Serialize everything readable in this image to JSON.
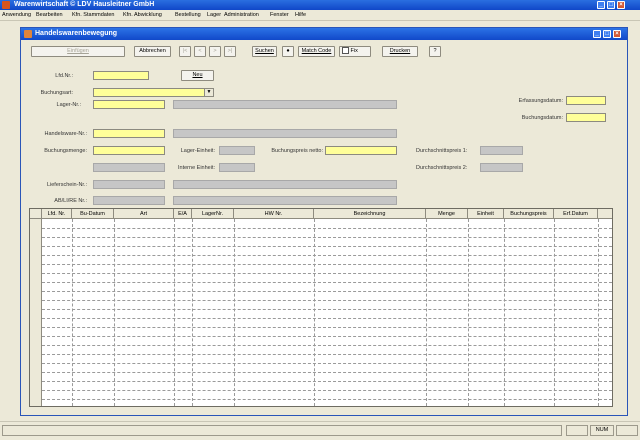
{
  "app": {
    "title": "Warenwirtschaft  © LDV Hausleitner GmbH"
  },
  "menu": [
    "Anwendung",
    "Bearbeiten",
    "Kfn. Stammdaten",
    "Kfn. Abwicklung",
    "Bestellung",
    "Lager",
    "Administration",
    "Fenster",
    "Hilfe"
  ],
  "window": {
    "title": "Handelswarenbewegung"
  },
  "toolbar": {
    "einfuegen": "Einfügen",
    "abbrechen": "Abbrechen",
    "nav_first": "|<",
    "nav_prev": "<",
    "nav_next": ">",
    "nav_last": ">|",
    "suchen": "Suchen",
    "dot": "●",
    "matchcode": "Match Code",
    "fix": "Fix",
    "drucken": "Drucken",
    "help": "?"
  },
  "form": {
    "lfd_nr": "Lfd.Nr.:",
    "neu": "Neu",
    "buchungsart": "Buchungsart:",
    "lager_nr": "Lager-Nr.:",
    "erfassungsdatum": "Erfassungsdatum:",
    "buchungsdatum": "Buchungsdatum:",
    "handelsware_nr": "Handelsware-Nr.:",
    "buchungsmenge": "Buchungsmenge:",
    "lager_einheit": "Lager-Einheit:",
    "buchungspreis_netto": "Buchungspreis netto:",
    "durchschnittspreis1": "Durchschnittspreis 1:",
    "interne_einheit": "Interne Einheit:",
    "durchschnittspreis2": "Durchschnittspreis 2:",
    "lieferschein_nr": "Lieferschein-Nr.:",
    "ab_li_re_nr": "AB/LI/RE Nr.:"
  },
  "grid": {
    "columns": [
      "Lfd. Nr.",
      "Bu-Datum",
      "Art",
      "E/A",
      "LagerNr.",
      "HW Nr.",
      "Bezeichnung",
      "Menge",
      "Einheit",
      "Buchungspreis",
      "Erf.Datum"
    ]
  },
  "status": {
    "num": "NUM"
  },
  "colors": {
    "title_blue": "#1a5bd6",
    "required_field": "#ffff99",
    "readonly_field": "#c6c6c6"
  }
}
